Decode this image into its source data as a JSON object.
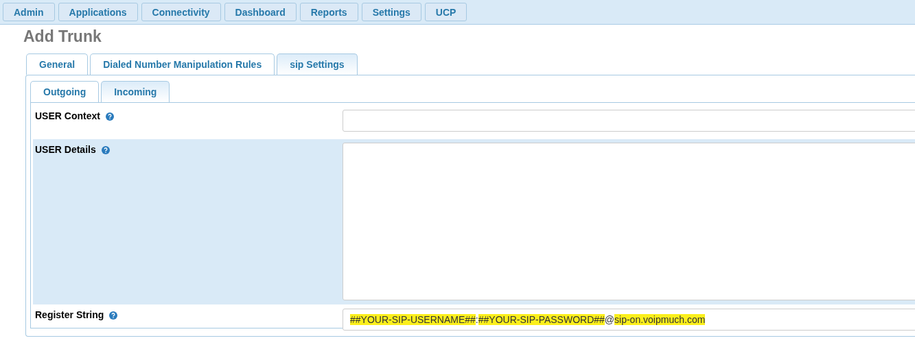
{
  "nav": [
    {
      "label": "Admin"
    },
    {
      "label": "Applications"
    },
    {
      "label": "Connectivity"
    },
    {
      "label": "Dashboard"
    },
    {
      "label": "Reports"
    },
    {
      "label": "Settings"
    },
    {
      "label": "UCP"
    }
  ],
  "page_title": "Add Trunk",
  "tabs": [
    {
      "label": "General",
      "selected": false
    },
    {
      "label": "Dialed Number Manipulation Rules",
      "selected": false
    },
    {
      "label": "sip Settings",
      "selected": true
    }
  ],
  "subtabs": [
    {
      "label": "Outgoing",
      "selected": false
    },
    {
      "label": "Incoming",
      "selected": true
    }
  ],
  "fields": [
    {
      "kind": "input",
      "label": "USER Context",
      "shaded": false
    },
    {
      "kind": "textarea",
      "label": "USER Details",
      "shaded": true
    },
    {
      "kind": "input",
      "label": "Register String",
      "shaded": false,
      "value_parts": [
        {
          "text": "##YOUR-SIP-USERNAME##",
          "highlighted": true
        },
        {
          "text": ":",
          "highlighted": false
        },
        {
          "text": "##YOUR-SIP-PASSWORD##",
          "highlighted": true
        },
        {
          "text": "@",
          "highlighted": false
        },
        {
          "text": "sip-on.voipmuch.com",
          "highlighted": true
        }
      ]
    }
  ]
}
